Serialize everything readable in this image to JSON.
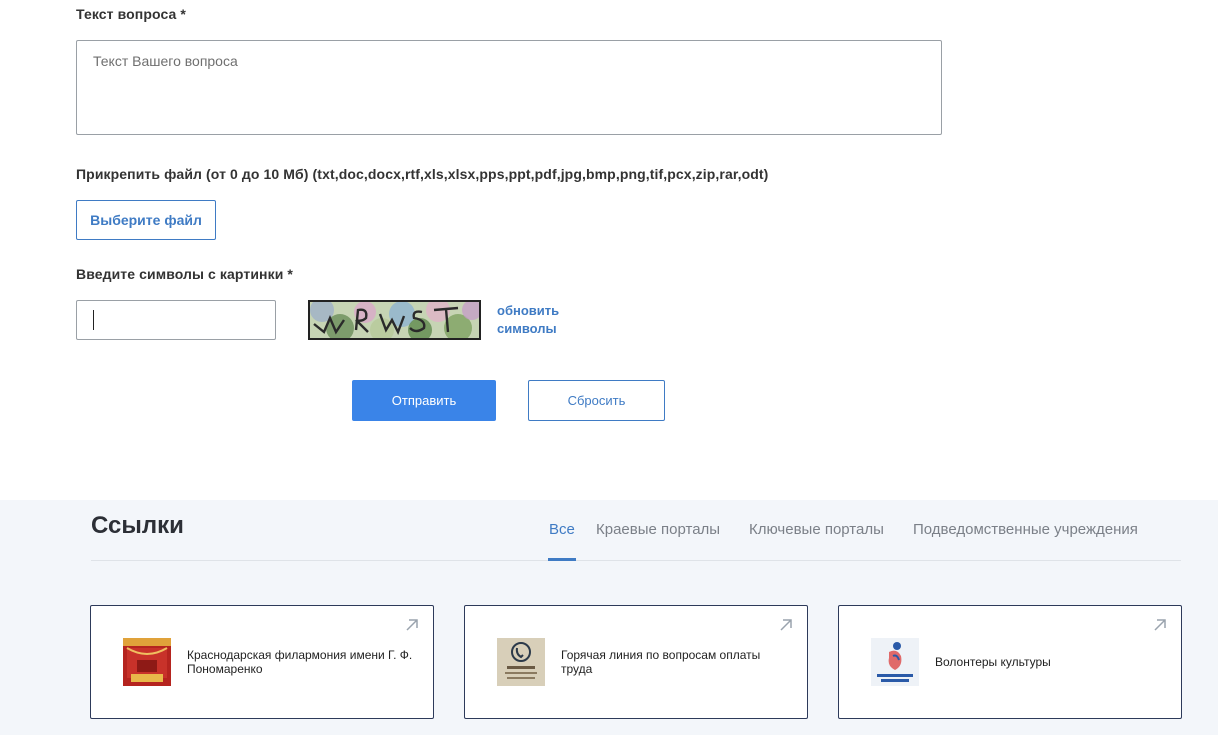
{
  "form": {
    "question_label": "Текст вопроса *",
    "question_placeholder": "Текст Вашего вопроса",
    "attach_label": "Прикрепить файл (от 0 до 10 Мб) (txt,doc,docx,rtf,xls,xlsx,pps,ppt,pdf,jpg,bmp,png,tif,pcx,zip,rar,odt)",
    "file_button": "Выберите файл",
    "captcha_label": "Введите символы с картинки *",
    "captcha_value": "",
    "refresh_line1": "обновить",
    "refresh_line2": "символы",
    "submit": "Отправить",
    "reset": "Сбросить"
  },
  "links": {
    "title": "Ссылки",
    "tabs": [
      {
        "label": "Все",
        "active": true
      },
      {
        "label": "Краевые порталы",
        "active": false
      },
      {
        "label": "Ключевые порталы",
        "active": false
      },
      {
        "label": "Подведомственные учреждения",
        "active": false
      }
    ],
    "cards": [
      {
        "title": "Краснодарская филармония имени Г. Ф. Пономаренко",
        "icon": "philharmonic-logo-icon"
      },
      {
        "title": "Горячая линия по вопросам оплаты труда",
        "icon": "hotline-phone-icon"
      },
      {
        "title": "Волонтеры культуры",
        "icon": "volunteers-logo-icon"
      }
    ]
  },
  "colors": {
    "accent": "#3f7bc4",
    "submit_bg": "#3a84e8",
    "links_bg": "#f3f6fa",
    "card_border": "#2d3a5a"
  }
}
